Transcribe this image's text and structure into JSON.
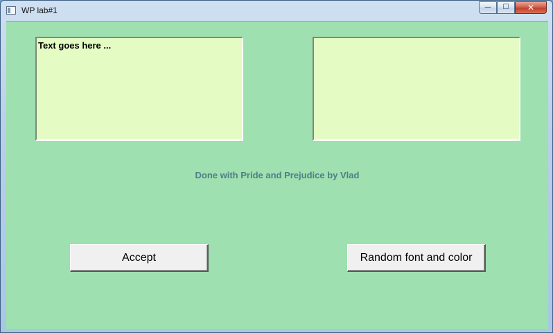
{
  "window": {
    "title": "WP lab#1",
    "controls": {
      "minimize": "—",
      "maximize": "☐",
      "close": "✕"
    }
  },
  "main": {
    "left_text": "Text goes here ...",
    "right_text": "",
    "credit": "Done with Pride and Prejudice by Vlad",
    "accept_label": "Accept",
    "random_label": "Random font and color"
  },
  "colors": {
    "client_background": "#9ee0b0",
    "edit_background": "#e4fbc4",
    "credit_text": "#4f7e86",
    "button_face": "#f0f0f0"
  }
}
